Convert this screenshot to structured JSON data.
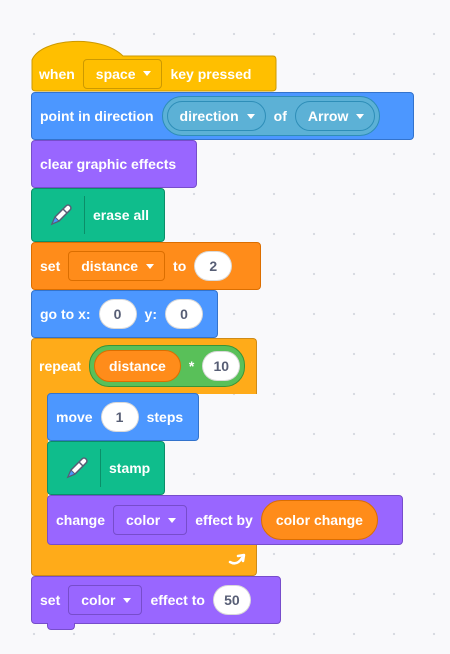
{
  "script": {
    "when_key": {
      "when_label": "when",
      "key_value": "space",
      "suffix_label": "key pressed"
    },
    "point_in_direction": {
      "label": "point in direction",
      "property_value": "direction",
      "of_label": "of",
      "target_value": "Arrow"
    },
    "clear_effects": {
      "label": "clear graphic effects"
    },
    "erase_all": {
      "label": "erase all"
    },
    "set_variable": {
      "set_label": "set",
      "variable_value": "distance",
      "to_label": "to",
      "value": "2"
    },
    "go_to_xy": {
      "label": "go to x:",
      "x_value": "0",
      "y_label": "y:",
      "y_value": "0"
    },
    "repeat": {
      "label": "repeat",
      "operand_variable": "distance",
      "operator": "*",
      "operand_number": "10"
    },
    "move_steps": {
      "move_label": "move",
      "steps_value": "1",
      "steps_label": "steps"
    },
    "stamp": {
      "label": "stamp"
    },
    "change_effect": {
      "change_label": "change",
      "effect_value": "color",
      "by_label": "effect by",
      "amount_variable": "color change"
    },
    "set_effect": {
      "set_label": "set",
      "effect_value": "color",
      "to_label": "effect to",
      "value": "50"
    }
  },
  "colors": {
    "events": "#ffbf00",
    "motion": "#4c97ff",
    "looks": "#9966ff",
    "pen": "#0fbd8c",
    "variables": "#ff8c1a",
    "control": "#ffab19",
    "operators": "#59c059",
    "sensing": "#5cb1d6"
  },
  "icons": {
    "pen": "pen-icon",
    "repeat_arrow": "loop-arrow-icon"
  }
}
